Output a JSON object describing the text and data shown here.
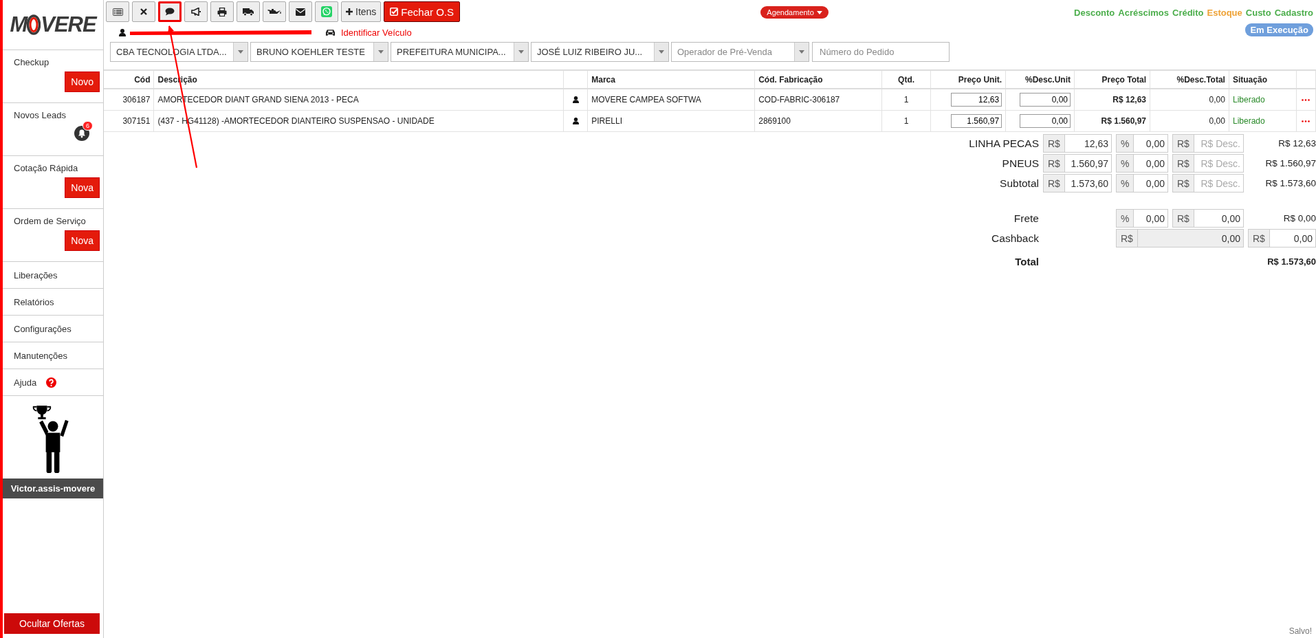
{
  "logo": {
    "before": "M",
    "after": "VERE"
  },
  "sidebar": {
    "items": [
      {
        "label": "Checkup",
        "kind": "action",
        "action": "Novo"
      },
      {
        "label": "Novos Leads",
        "kind": "bell",
        "badge": "6"
      },
      {
        "label": "Cotação Rápida",
        "kind": "action",
        "action": "Nova"
      },
      {
        "label": "Ordem de Serviço",
        "kind": "action",
        "action": "Nova"
      },
      {
        "label": "Liberações",
        "kind": "link"
      },
      {
        "label": "Relatórios",
        "kind": "link"
      },
      {
        "label": "Configurações",
        "kind": "link"
      },
      {
        "label": "Manutenções",
        "kind": "link"
      },
      {
        "label": "Ajuda",
        "kind": "help"
      }
    ],
    "user": "Victor.assis-movere",
    "hide_offers_button": "Ocultar Ofertas"
  },
  "toolbar": [
    {
      "kind": "list",
      "highlighted": false
    },
    {
      "kind": "close",
      "highlighted": false
    },
    {
      "kind": "comment",
      "highlighted": true
    },
    {
      "kind": "megaphone",
      "highlighted": false
    },
    {
      "kind": "print",
      "highlighted": false
    },
    {
      "kind": "truck",
      "highlighted": false
    },
    {
      "kind": "oil",
      "highlighted": false
    },
    {
      "kind": "mail",
      "highlighted": false
    },
    {
      "kind": "whatsapp",
      "highlighted": false
    },
    {
      "kind": "add",
      "label": "Itens",
      "highlighted": false
    },
    {
      "kind": "close_order",
      "label": "Fechar O.S",
      "highlighted": false
    }
  ],
  "schedule_button": "Agendamento",
  "top_links": [
    {
      "label": "Desconto",
      "color": "#4cae4c"
    },
    {
      "label": "Acréscimos",
      "color": "#4cae4c"
    },
    {
      "label": "Crédito",
      "color": "#4cae4c"
    },
    {
      "label": "Estoque",
      "color": "#eea236"
    },
    {
      "label": "Custo",
      "color": "#4cae4c"
    },
    {
      "label": "Cadastro",
      "color": "#4cae4c"
    }
  ],
  "status_badge": "Em Execução",
  "vehicle_link": "Identificar Veículo",
  "selects": [
    {
      "value": "CBA TECNOLOGIA LTDA..."
    },
    {
      "value": "BRUNO KOEHLER TESTE"
    },
    {
      "value": "PREFEITURA MUNICIPA..."
    },
    {
      "value": "JOSÉ LUIZ RIBEIRO JU..."
    },
    {
      "placeholder": "Operador de Pré-Venda"
    }
  ],
  "order_number": {
    "placeholder": "Número do Pedido"
  },
  "table": {
    "columns": [
      {
        "label": "Cód",
        "kind": "text"
      },
      {
        "label": "Descrição",
        "kind": "text"
      },
      {
        "kind": "icon"
      },
      {
        "label": "Marca",
        "kind": "text"
      },
      {
        "label": "Cód. Fabricação",
        "kind": "text"
      },
      {
        "label": "Qtd.",
        "kind": "text"
      },
      {
        "label": "Preço Unit.",
        "kind": "text"
      },
      {
        "label": "%Desc.Unit",
        "kind": "text"
      },
      {
        "label": "Preço Total",
        "kind": "text"
      },
      {
        "label": "%Desc.Total",
        "kind": "text"
      },
      {
        "label": "Situação",
        "kind": "text"
      },
      {
        "kind": "actions"
      }
    ],
    "rows": [
      {
        "code": "306187",
        "description": "AMORTECEDOR DIANT GRAND SIENA 2013 - PECA",
        "brand": "MOVERE CAMPEA SOFTWA",
        "manufacturer_code": "COD-FABRIC-306187",
        "qty": "1",
        "unit_price": "12,63",
        "unit_discount": "0,00",
        "total_price": "R$ 12,63",
        "total_discount": "0,00",
        "status": "Liberado"
      },
      {
        "code": "307151",
        "description": "(437 - HG41128) -AMORTECEDOR DIANTEIRO SUSPENSAO - UNIDADE",
        "brand": "PIRELLI",
        "manufacturer_code": "2869100",
        "qty": "1",
        "unit_price": "1.560,97",
        "unit_discount": "0,00",
        "total_price": "R$ 1.560,97",
        "total_discount": "0,00",
        "status": "Liberado"
      }
    ]
  },
  "totals": {
    "lines": [
      {
        "label": "LINHA PECAS",
        "amount": {
          "prefix": "R$",
          "value": "12,63"
        },
        "percent": {
          "prefix": "%",
          "value": "0,00"
        },
        "discount": {
          "prefix": "R$",
          "placeholder": "R$ Desc."
        },
        "result": "R$ 12,63"
      },
      {
        "label": "PNEUS",
        "amount": {
          "prefix": "R$",
          "value": "1.560,97"
        },
        "percent": {
          "prefix": "%",
          "value": "0,00"
        },
        "discount": {
          "prefix": "R$",
          "placeholder": "R$ Desc."
        },
        "result": "R$ 1.560,97"
      },
      {
        "label": "Subtotal",
        "amount": {
          "prefix": "R$",
          "value": "1.573,60"
        },
        "percent": {
          "prefix": "%",
          "value": "0,00"
        },
        "discount": {
          "prefix": "R$",
          "placeholder": "R$ Desc."
        },
        "result": "R$ 1.573,60"
      }
    ],
    "freight": {
      "label": "Frete",
      "percent": {
        "prefix": "%",
        "value": "0,00"
      },
      "amount": {
        "prefix": "R$",
        "value": "0,00"
      },
      "result": "R$ 0,00"
    },
    "cashback": {
      "label": "Cashback",
      "balance": {
        "prefix": "R$",
        "value": "0,00",
        "disabled": true
      },
      "amount": {
        "prefix": "R$",
        "value": "0,00"
      }
    },
    "total": {
      "label": "Total",
      "value": "R$ 1.573,60"
    }
  },
  "save_status": "Salvo!"
}
